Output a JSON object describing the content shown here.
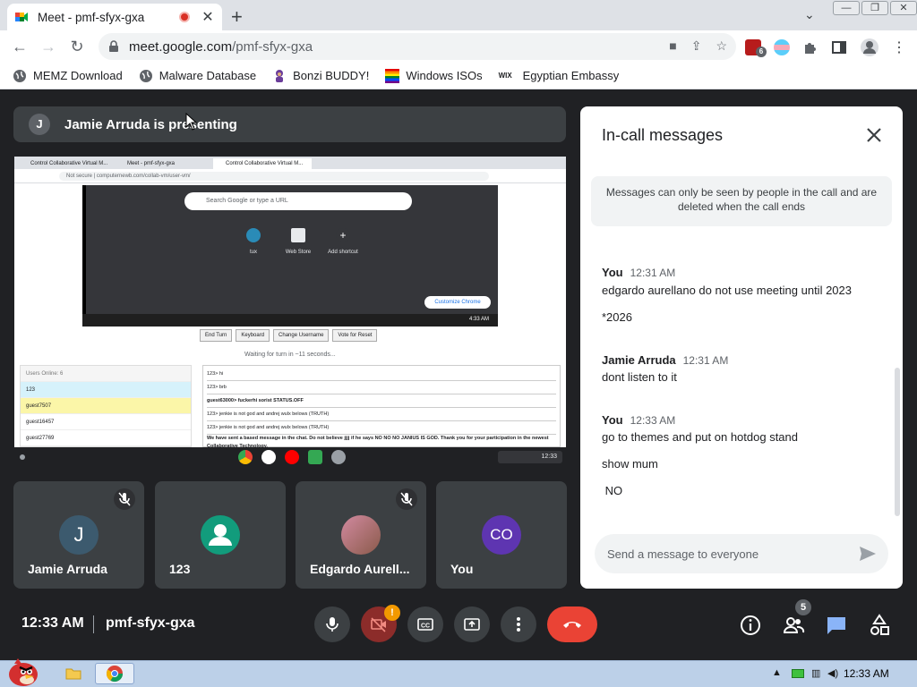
{
  "browser": {
    "tab_title": "Meet - pmf-sfyx-gxa",
    "url_host": "meet.google.com",
    "url_path": "/pmf-sfyx-gxa",
    "extension_badge": "6",
    "bookmarks": [
      {
        "label": "MEMZ Download"
      },
      {
        "label": "Malware Database"
      },
      {
        "label": "Bonzi BUDDY!"
      },
      {
        "label": "Windows ISOs"
      },
      {
        "label": "Egyptian Embassy"
      }
    ],
    "favicon_bonzi": "purple-gorilla-icon",
    "favicon_wix": "WIX",
    "colors": {
      "tabstrip": "#dee1e6",
      "omnibox": "#f1f3f4"
    }
  },
  "meet": {
    "presenter_initial": "J",
    "presenter_banner": "Jamie Arruda is presenting",
    "shared_screen": {
      "tabs": [
        "Control Collaborative Virtual M...",
        "Meet - pmf-sfyx-gxa",
        "Control Collaborative Virtual M..."
      ],
      "url": "Not secure | computernewb.com/collab-vm/user-vm/",
      "search_placeholder": "Search Google or type a URL",
      "shortcuts": [
        "tux",
        "Web Store",
        "Add shortcut"
      ],
      "customize": "Customize Chrome",
      "buttons": [
        "End Turn",
        "Keyboard",
        "Change Username",
        "Vote for Reset"
      ],
      "wait_text": "Waiting for turn in ~11 seconds...",
      "users_header": "Users Online: 6",
      "users": [
        "123",
        "guest7507",
        "guest16457",
        "guest27769"
      ],
      "chat": [
        "123> hi",
        "123> brb",
        "guest63000> fuckerhi sorist STATUS.OFF",
        "123> jenkie is not god and andrej wulx belows (TRUTH)",
        "123> jenkie is not god and andrej wulx belows (TRUTH)",
        "We have sent a based message in the chat. Do not believe jjjj if he says NO NO NO JANIUS IS GOD. Thank you for your participation in the newest Collaborative Technology."
      ],
      "clock": "4:33 AM"
    },
    "tiles": [
      {
        "initial": "J",
        "name": "Jamie Arruda",
        "avatar_color": "#3c5a6e"
      },
      {
        "initial": "",
        "name": "123",
        "avatar_color": "#129c7c"
      },
      {
        "initial": "",
        "name": "Edgardo Aurell...",
        "avatar_color": "#a86b7a"
      },
      {
        "initial": "CO",
        "name": "You",
        "avatar_color": "#5e35b1"
      }
    ],
    "time": "12:33 AM",
    "code": "pmf-sfyx-gxa",
    "camera_badge": "!",
    "people_count": "5",
    "end_color": "#ea4335",
    "accent": "#1a73e8"
  },
  "chat": {
    "title": "In-call messages",
    "info": "Messages can only be seen by people in the call and are deleted when the call ends",
    "messages": [
      {
        "sender": "You",
        "time": "12:31 AM",
        "lines": [
          "edgardo aurellano do not use meeting until 2023",
          "*2026"
        ]
      },
      {
        "sender": "Jamie Arruda",
        "time": "12:31 AM",
        "lines": [
          "dont listen to it"
        ]
      },
      {
        "sender": "You",
        "time": "12:33 AM",
        "lines": [
          "go to themes and put on hotdog stand",
          "show mum",
          " NO"
        ]
      }
    ],
    "input_placeholder": "Send a message to everyone"
  },
  "taskbar": {
    "clock": "12:33 AM"
  }
}
